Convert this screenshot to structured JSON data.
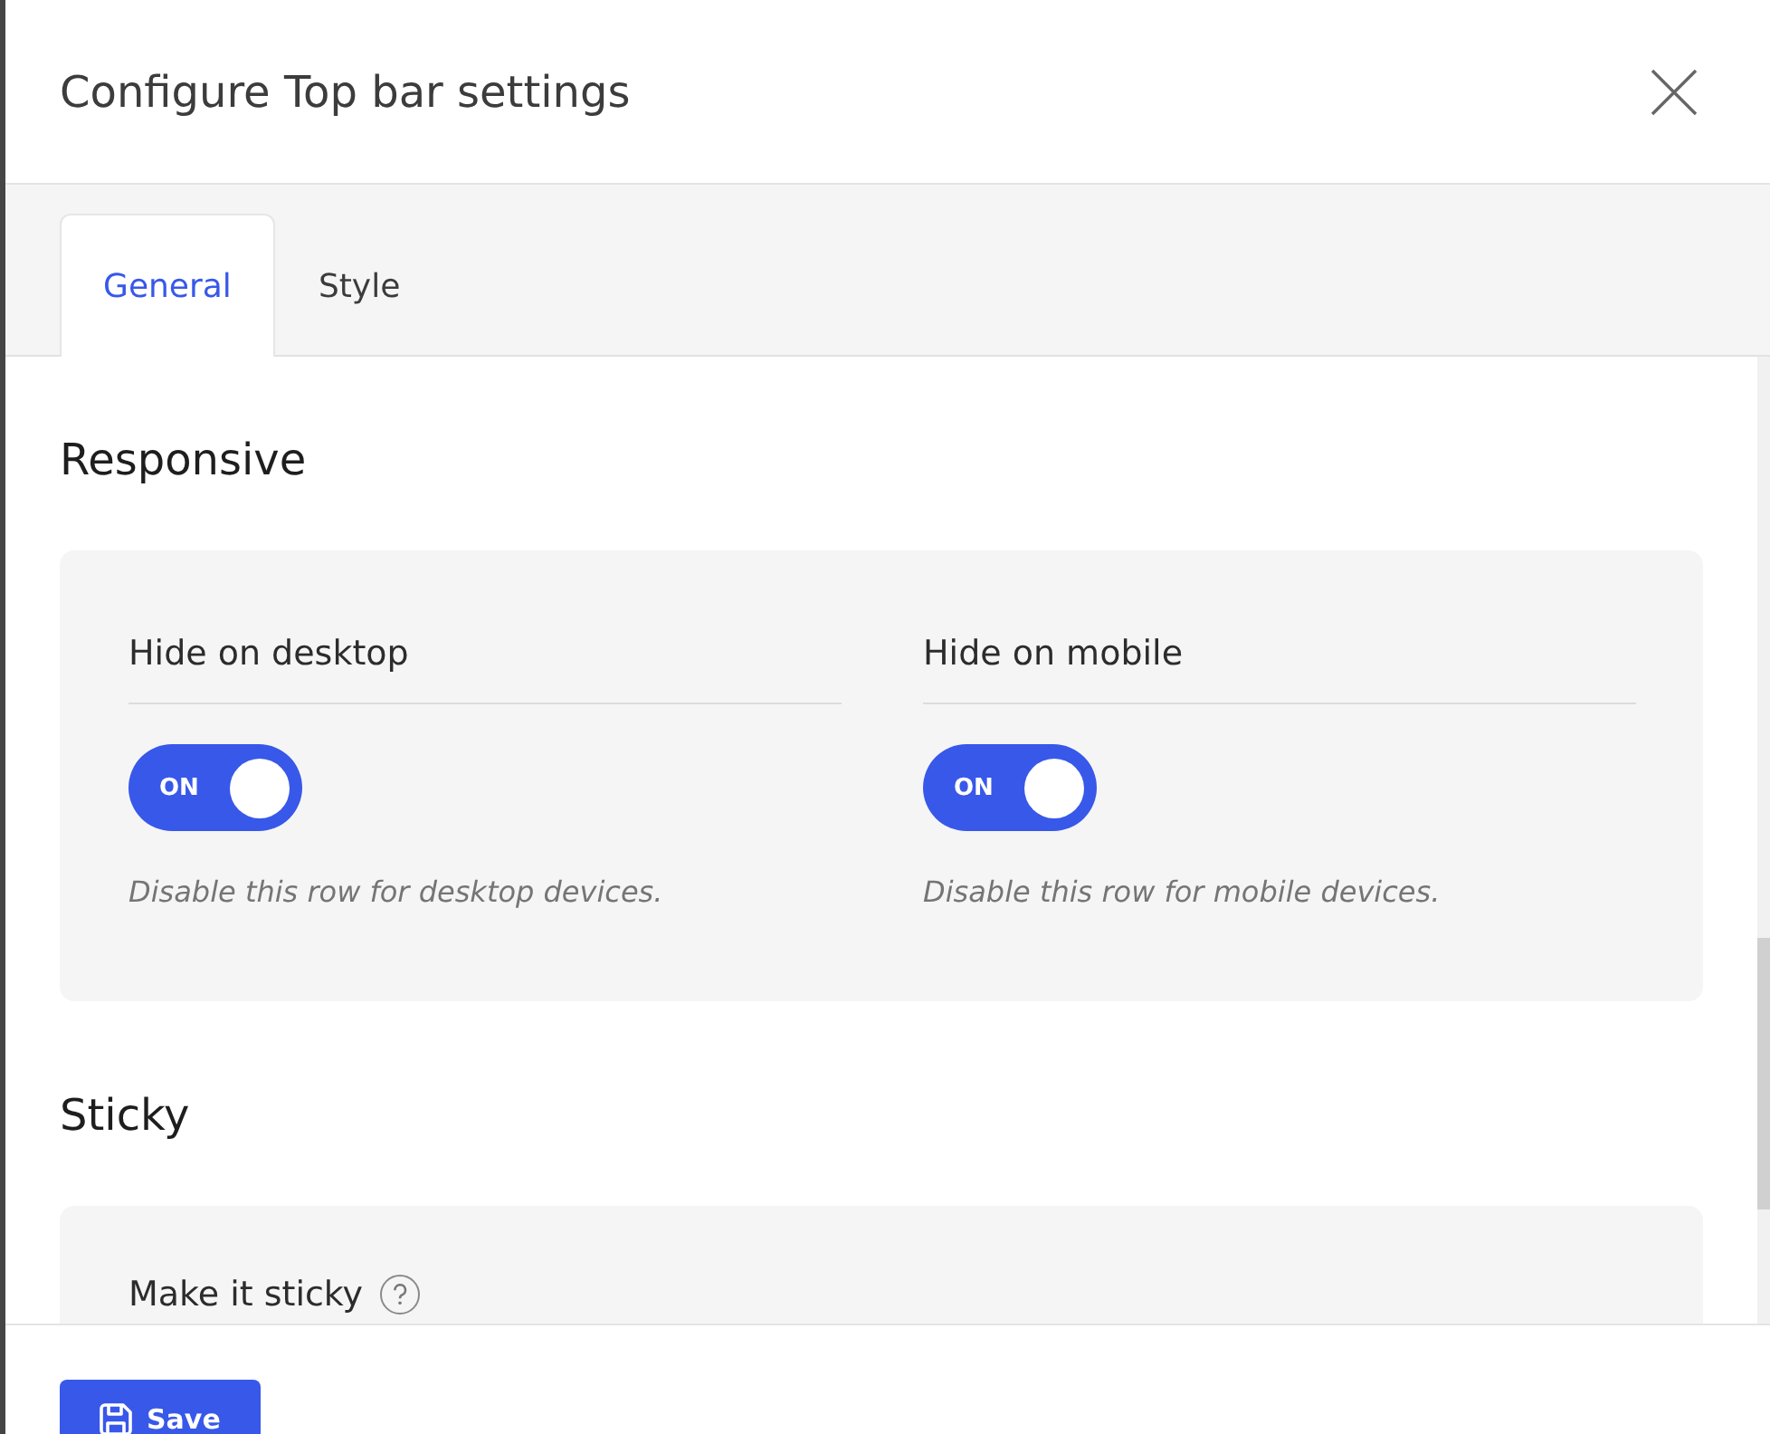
{
  "dialog": {
    "title": "Configure Top bar settings"
  },
  "tabs": [
    {
      "label": "General",
      "selected": true
    },
    {
      "label": "Style",
      "selected": false
    }
  ],
  "sections": [
    {
      "heading": "Responsive",
      "settings": [
        {
          "kind": "toggle",
          "label": "Hide on desktop",
          "help": false,
          "on": true,
          "toggle_text": "ON",
          "description": "Disable this row for desktop devices."
        },
        {
          "kind": "toggle",
          "label": "Hide on mobile",
          "help": false,
          "on": true,
          "toggle_text": "ON",
          "description": "Disable this row for mobile devices."
        }
      ]
    },
    {
      "heading": "Sticky",
      "settings": [
        {
          "kind": "label",
          "label": "Make it sticky",
          "help": true
        }
      ]
    }
  ],
  "footer": {
    "save_label": "Save"
  }
}
